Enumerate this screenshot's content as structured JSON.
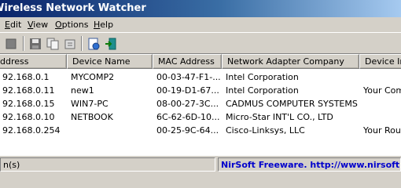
{
  "window": {
    "title": "Wireless Network Watcher"
  },
  "menu": {
    "items": [
      {
        "label": "Edit",
        "underline": "E",
        "rest": "dit"
      },
      {
        "label": "View",
        "underline": "V",
        "rest": "iew"
      },
      {
        "label": "Options",
        "underline": "O",
        "rest": "ptions"
      },
      {
        "label": "Help",
        "underline": "H",
        "rest": "elp"
      }
    ]
  },
  "toolbar": {
    "buttons": [
      {
        "icon": "stop-icon"
      },
      {
        "icon": "save-icon"
      },
      {
        "icon": "copy-icon"
      },
      {
        "icon": "properties-icon"
      },
      {
        "icon": "html-report-icon"
      },
      {
        "icon": "exit-icon"
      }
    ]
  },
  "table": {
    "columns": [
      "ddress",
      "Device Name",
      "MAC Address",
      "Network Adapter Company",
      "Device Inf"
    ],
    "rows": [
      [
        "92.168.0.1",
        "MYCOMP2",
        "00-03-47-F1-...",
        "Intel Corporation",
        ""
      ],
      [
        "92.168.0.11",
        "new1",
        "00-19-D1-67...",
        "Intel Corporation",
        "Your Comp"
      ],
      [
        "92.168.0.15",
        "WIN7-PC",
        "08-00-27-3C...",
        "CADMUS COMPUTER SYSTEMS",
        ""
      ],
      [
        "92.168.0.10",
        "NETBOOK",
        "6C-62-6D-10...",
        "Micro-Star INT'L CO., LTD",
        ""
      ],
      [
        "92.168.0.254",
        "",
        "00-25-9C-64...",
        "Cisco-Linksys, LLC",
        "Your Rout"
      ]
    ]
  },
  "status": {
    "count_text": "n(s)",
    "credit_text": "NirSoft Freeware.  http://www.nirsoft.net"
  },
  "colors": {
    "title_start": "#0a246a",
    "title_end": "#a6caf0",
    "link": "#0000cc"
  }
}
